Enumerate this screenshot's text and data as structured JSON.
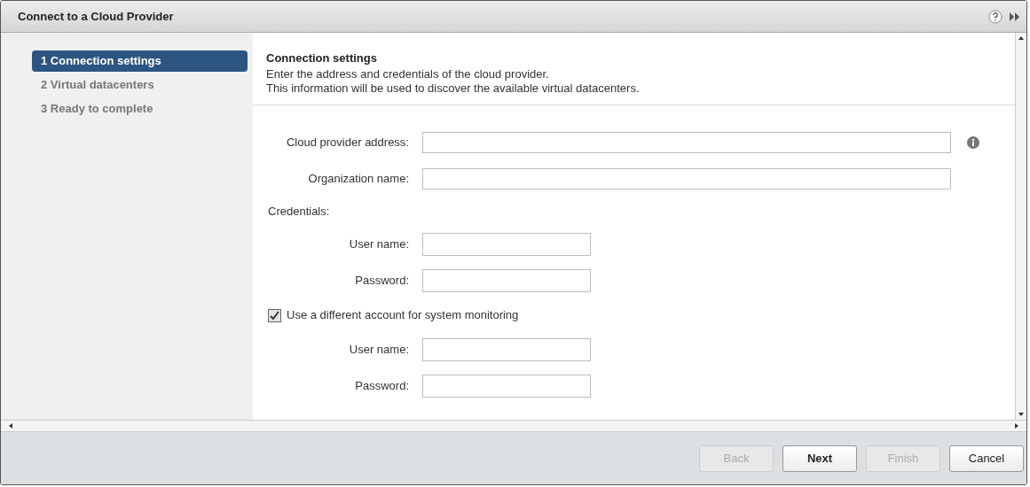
{
  "window": {
    "title": "Connect to a Cloud Provider"
  },
  "steps": [
    {
      "label": "1 Connection settings",
      "selected": true
    },
    {
      "label": "2 Virtual datacenters",
      "selected": false
    },
    {
      "label": "3 Ready to complete",
      "selected": false
    }
  ],
  "header": {
    "title": "Connection settings",
    "lines": [
      "Enter the address and credentials of the cloud provider.",
      "This information will be used to discover the available virtual datacenters."
    ]
  },
  "form": [
    {
      "kind": "wide",
      "label": "Cloud provider address:",
      "info": true
    },
    {
      "kind": "wide",
      "label": "Organization name:",
      "info": false
    },
    {
      "kind": "heading",
      "label": "Credentials:"
    },
    {
      "kind": "narrow",
      "label": "User name:"
    },
    {
      "kind": "narrow",
      "label": "Password:"
    },
    {
      "kind": "checkbox",
      "label": "Use a different account for system monitoring",
      "checked": true
    },
    {
      "kind": "narrow",
      "label": "User name:"
    },
    {
      "kind": "narrow",
      "label": "Password:"
    }
  ],
  "buttons": [
    {
      "label": "Back",
      "disabled": true,
      "primary": false
    },
    {
      "label": "Next",
      "disabled": false,
      "primary": true
    },
    {
      "label": "Finish",
      "disabled": true,
      "primary": false
    },
    {
      "label": "Cancel",
      "disabled": false,
      "primary": false
    }
  ]
}
